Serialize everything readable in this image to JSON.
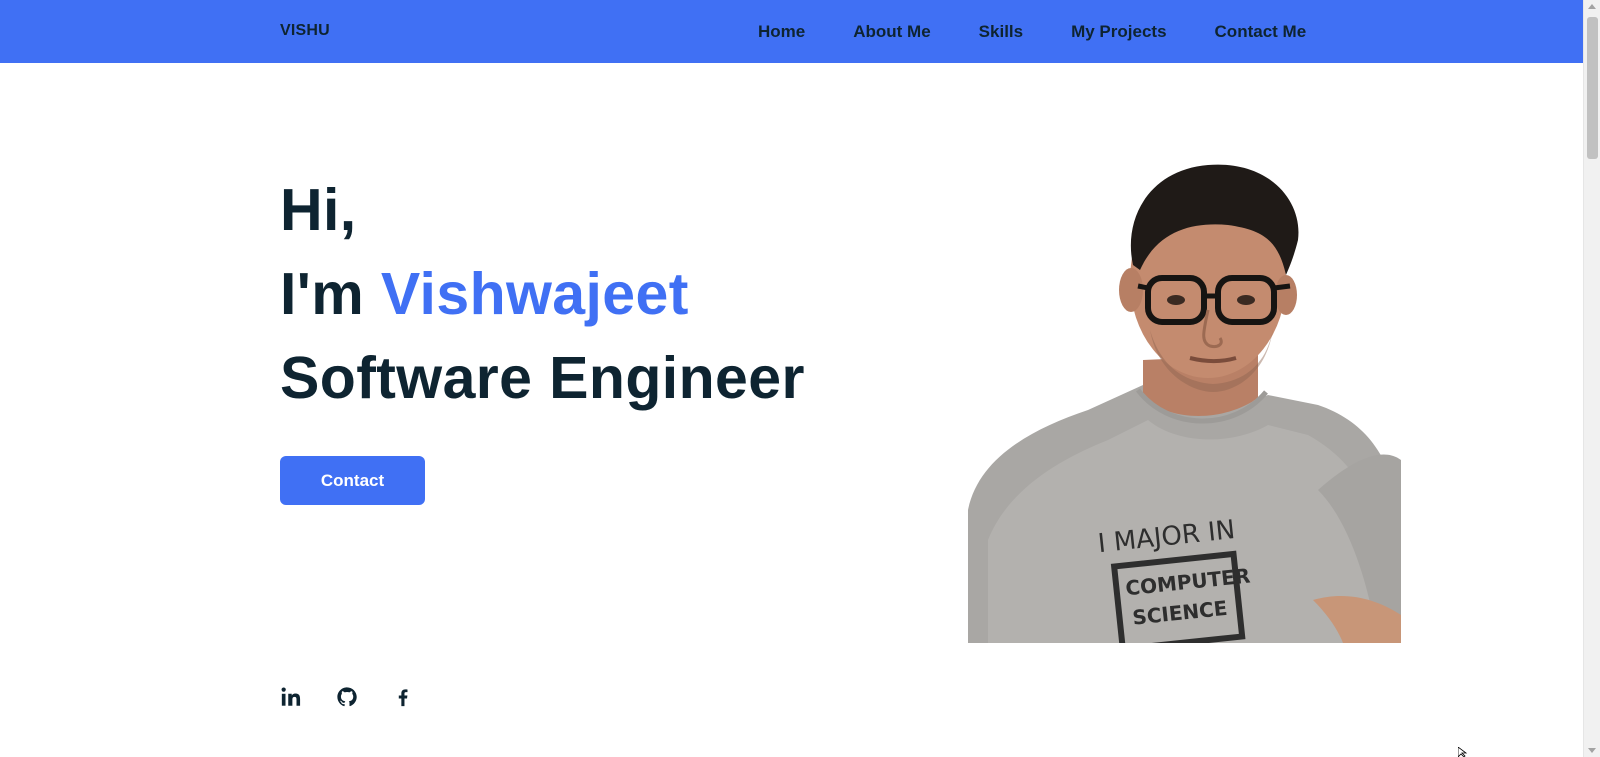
{
  "header": {
    "logo": "VISHU",
    "nav": [
      "Home",
      "About Me",
      "Skills",
      "My Projects",
      "Contact Me"
    ]
  },
  "hero": {
    "greeting": "Hi,",
    "intro_prefix": "I'm ",
    "name": "Vishwajeet",
    "role": "Software Engineer",
    "contact_button": "Contact"
  },
  "portrait": {
    "shirt_text_line1": "I MAJOR IN",
    "shirt_text_line2": "COMPUTER",
    "shirt_text_line3": "SCIENCE"
  },
  "social": [
    "linkedin-icon",
    "github-icon",
    "facebook-icon"
  ],
  "colors": {
    "primary": "#4070f4",
    "text_dark": "#0e2431",
    "background": "#ffffff"
  }
}
